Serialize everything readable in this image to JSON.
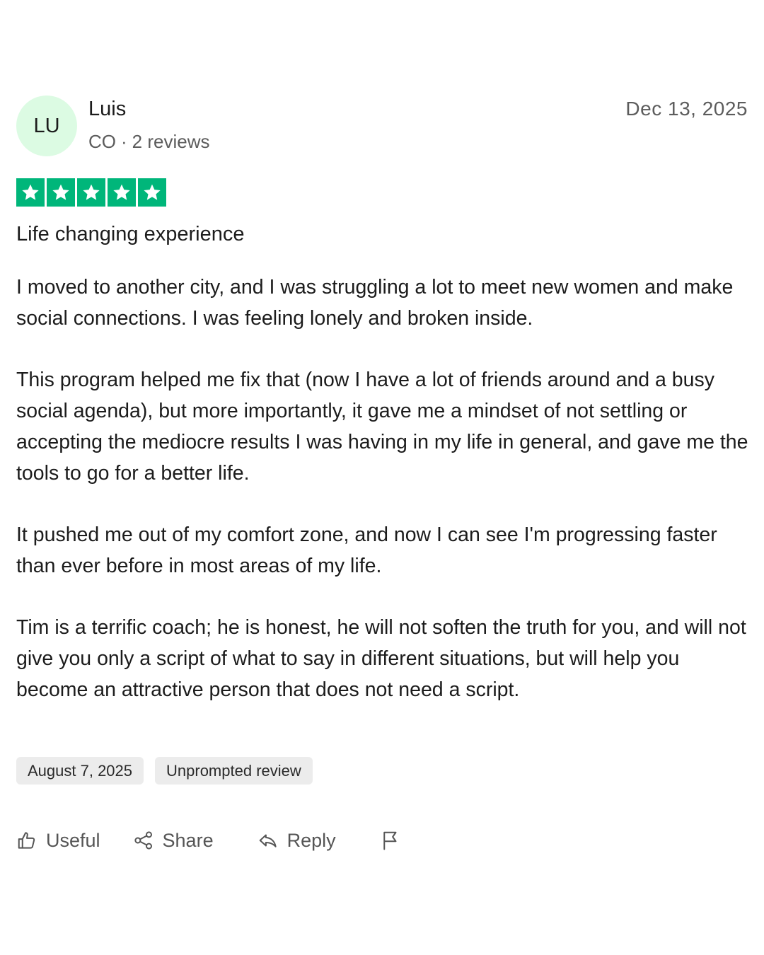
{
  "author": {
    "initials": "LU",
    "name": "Luis",
    "country": "CO",
    "reviews": "2 reviews",
    "avatar_color": "#dcfbe3"
  },
  "review": {
    "date": "Dec 13, 2025",
    "rating": 5,
    "rating_max": 5,
    "star_color": "#00b67a",
    "title": "Life changing experience",
    "paragraphs": [
      "I moved to another city, and I was struggling a lot to meet new women and make social connections. I was feeling lonely and broken inside.",
      "This program helped me fix that (now I have a lot of friends around and a busy social agenda), but more importantly, it gave me a mindset of not settling or accepting the mediocre results I was having in my life in general, and gave me the tools to go for a better life.",
      "It pushed me out of my comfort zone, and now I can see I'm progressing faster than ever before in most areas of my life.",
      "Tim is a terrific coach; he is honest, he will not soften the truth for you, and will not give you only a script of what to say in different situations, but will help you become an attractive person that does not need a script."
    ],
    "experience_date": "August 7, 2025",
    "tag": "Unprompted review"
  },
  "actions": {
    "useful": "Useful",
    "share": "Share",
    "reply": "Reply",
    "icons": [
      "thumbs-up-icon",
      "share-icon",
      "reply-icon",
      "flag-icon"
    ]
  }
}
